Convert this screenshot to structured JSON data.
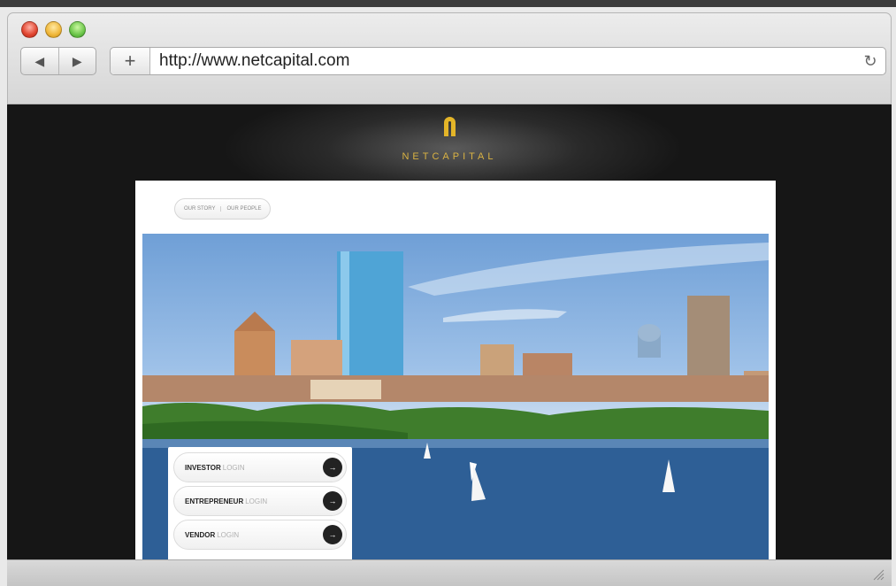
{
  "browser": {
    "url": "http://www.netcapital.com",
    "back_icon": "◀",
    "forward_icon": "▶",
    "add_icon": "+",
    "reload_icon": "↻"
  },
  "site": {
    "brand": "NETCAPITAL",
    "nav": [
      "OUR STORY",
      "OUR PEOPLE"
    ],
    "logins": [
      {
        "role": "INVESTOR",
        "suffix": "LOGIN"
      },
      {
        "role": "ENTREPRENEUR",
        "suffix": "LOGIN"
      },
      {
        "role": "VENDOR",
        "suffix": "LOGIN"
      }
    ],
    "go_icon": "→"
  },
  "colors": {
    "brand_gold": "#d9b243"
  }
}
